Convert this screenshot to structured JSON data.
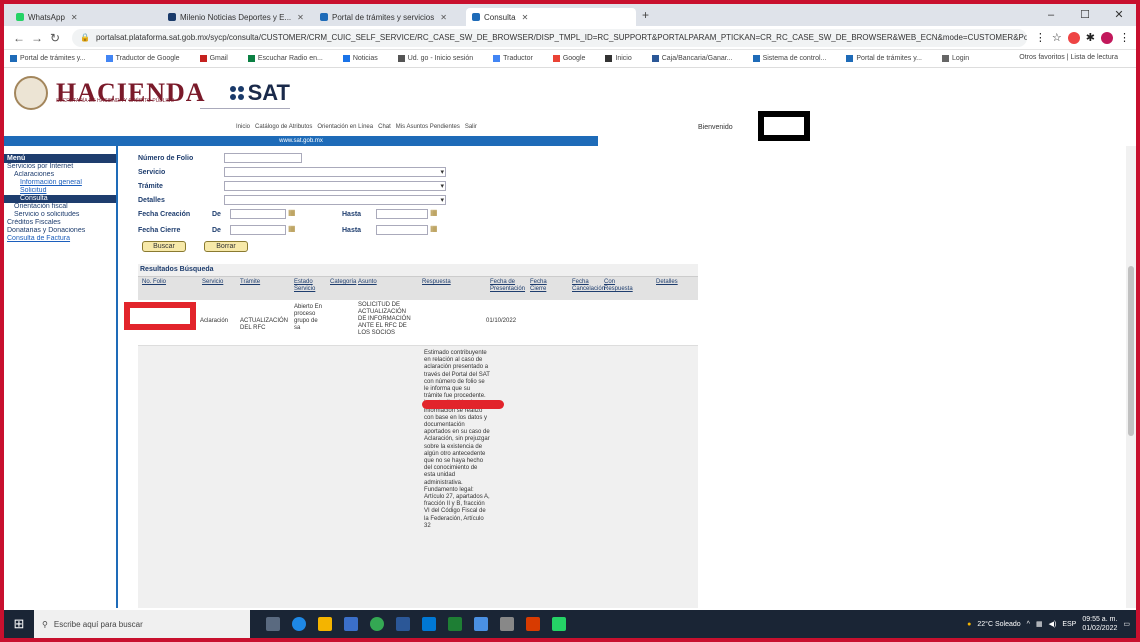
{
  "browser": {
    "tabs": [
      {
        "label": "WhatsApp",
        "color": "#25d366",
        "active": false
      },
      {
        "label": "Milenio Noticias Deportes y E...",
        "color": "#1a3a6a",
        "active": false
      },
      {
        "label": "Portal de trámites y servicios",
        "color": "#1e6bb8",
        "active": false
      },
      {
        "label": "Consulta",
        "color": "#1e6bb8",
        "active": true
      }
    ],
    "new_tab": "+",
    "window_controls": [
      "–",
      "☐",
      "✕"
    ],
    "url": "portalsat.plataforma.sat.gob.mx/sycp/consulta/CUSTOMER/CRM_CUIC_SELF_SERVICE/RC_CASE_SW_DE_BROWSER/DISP_TMPL_ID=RC_SUPPORT&PORTALPARAM_PTICKAN=CR_RC_CASE_SW_DE_BROWSER&WEB_ECN&mode=CUSTOMER&Portal=CUSTOME...",
    "bookmarks": [
      "Portal de trámites y...",
      "Traductor de Google",
      "Gmail",
      "Escuchar Radio en...",
      "Noticias",
      "Ud. go - Inicio sesión",
      "Traductor",
      "Google",
      "Inicio",
      "Caja/Bancaria/Ganar...",
      "Sistema de control...",
      "Portal de trámites y...",
      "Login"
    ],
    "bookmarks_right": "Otros favoritos   |   Lista de lectura"
  },
  "site": {
    "logo_text": "HACIENDA",
    "logo_subtitle": "SECRETARÍA DE HACIENDA Y CRÉDITO PÚBLICO",
    "sat_text": "SAT",
    "topnav": [
      "Inicio",
      "Catálogo de Atributos",
      "Orientación en Línea",
      "Chat",
      "Mis Asuntos Pendientes",
      "Salir"
    ],
    "bienvenido": "Bienvenido",
    "bluebar": "www.sat.gob.mx"
  },
  "menu": {
    "title": "Menú",
    "items": [
      {
        "label": "Servicios por Internet",
        "level": 0
      },
      {
        "label": "Aclaraciones",
        "level": 1
      },
      {
        "label": "Información general",
        "level": 2
      },
      {
        "label": "Solicitud",
        "level": 2
      },
      {
        "label": "Consulta",
        "level": 3
      },
      {
        "label": "Orientación fiscal",
        "level": 1
      },
      {
        "label": "Servicio o solicitudes",
        "level": 1
      },
      {
        "label": "Créditos Fiscales",
        "level": 0
      },
      {
        "label": "Donatarias y Donaciones",
        "level": 0
      },
      {
        "label": "Consulta de Factura",
        "level": 4
      }
    ]
  },
  "form": {
    "folio_label": "Número de Folio",
    "servicio_label": "Servicio",
    "tramite_label": "Trámite",
    "detalles_label": "Detalles",
    "fecha_creacion_label": "Fecha Creación",
    "fecha_cierre_label": "Fecha Cierre",
    "de_label": "De",
    "hasta_label": "Hasta",
    "buscar_label": "Buscar",
    "borrar_label": "Borrar"
  },
  "results": {
    "title": "Resultados Búsqueda",
    "columns": [
      "No. Folio",
      "Servicio",
      "Trámite",
      "Estado Servicio",
      "Categoría",
      "Asunto",
      "Respuesta",
      "Fecha de Presentación",
      "Fecha Cierre",
      "Fecha Cancelación",
      "Con Respuesta",
      "Detalles"
    ],
    "row": {
      "servicio": "Aclaración",
      "tramite": "ACTUALIZACIÓN DEL RFC",
      "estado": "Abierto En proceso grupo de sa",
      "asunto": "SOLICITUD DE ACTUALIZACIÓN DE INFORMACIÓN ANTE EL RFC DE LOS SOCIOS",
      "fecha_presentacion": "01/10/2022",
      "respuesta": "Estimado contribuyente en relación al caso de aclaración presentado a través del Portal del SAT con número de folio se le informa que su trámite fue procedente. La actualización de su información se realizó con base en los datos y documentación aportados en su caso de Aclaración, sin prejuzgar sobre la existencia de algún otro antecedente que no se haya hecho del conocimiento de esta unidad administrativa. Fundamento legal: Artículo 27, apartados A, fracción II y B, fracción VI del Código Fiscal de la Federación, Artículo 32"
    }
  },
  "taskbar": {
    "search_placeholder": "Escribe aquí para buscar",
    "weather": "22°C Soleado",
    "lang": "ESP",
    "time": "09:55 a. m.",
    "date": "01/02/2022"
  }
}
